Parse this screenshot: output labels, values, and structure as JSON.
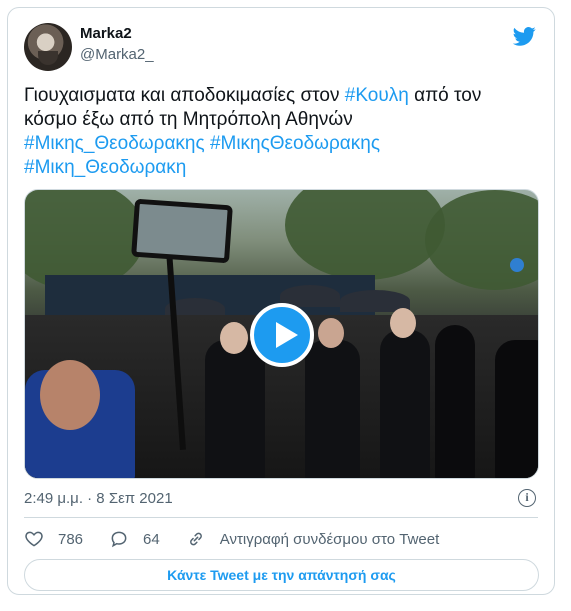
{
  "author": {
    "name": "Marka2",
    "handle": "@Marka2_"
  },
  "tweet": {
    "text_line1_prefix": "Γιουχαισματα και αποδοκιμασίες στον ",
    "tag_koulh": "#Κουλη",
    "text_line1_suffix": " από τον",
    "text_line2": "κόσμο έξω από τη Μητρόπολη Αθηνών",
    "tag_1": "#Μικης_Θεοδωρακης",
    "tag_2": "#ΜικηςΘεοδωρακης",
    "tag_3": "#Μικη_Θεοδωρακη"
  },
  "media": {
    "type": "video",
    "play_icon": "play-icon"
  },
  "meta": {
    "timestamp": "2:49 μ.μ. · 8 Σεπ 2021"
  },
  "actions": {
    "likes": "786",
    "replies": "64",
    "copy_link": "Αντιγραφή συνδέσμου στο Tweet"
  },
  "reply_button": "Κάντε Tweet με την απάντησή σας",
  "colors": {
    "accent": "#1d9bf0",
    "muted": "#536471",
    "border": "#cfd9de"
  }
}
